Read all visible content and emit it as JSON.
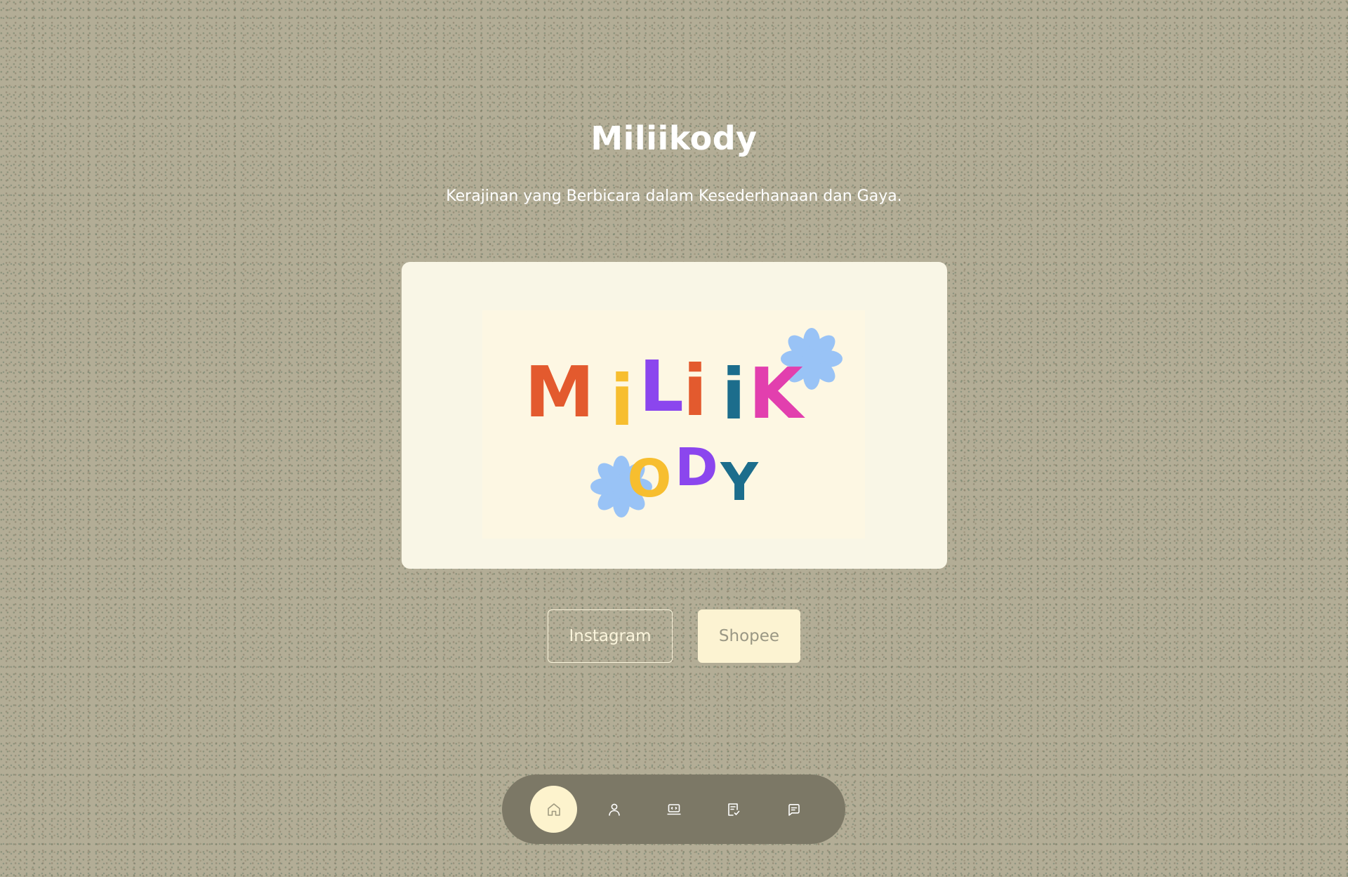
{
  "header": {
    "title": "Miliikody",
    "tagline": "Kerajinan yang Berbicara dalam Kesederhanaan dan Gaya."
  },
  "hero": {
    "logo_text_line1": [
      "M",
      "i",
      "L",
      "i",
      "i",
      "K"
    ],
    "logo_text_line2": [
      "O",
      "D",
      "Y"
    ]
  },
  "links": {
    "instagram_label": "Instagram",
    "shopee_label": "Shopee"
  },
  "dock": {
    "items": [
      {
        "icon": "home-icon",
        "active": true
      },
      {
        "icon": "user-icon",
        "active": false
      },
      {
        "icon": "laptop-icon",
        "active": false
      },
      {
        "icon": "checklist-icon",
        "active": false
      },
      {
        "icon": "message-icon",
        "active": false
      }
    ]
  },
  "colors": {
    "background": "#b3ad96",
    "card": "#f9f6e6",
    "logo_orange": "#e35a2e",
    "logo_yellow": "#f7be2f",
    "logo_purple": "#8b46ee",
    "logo_teal": "#1c6d8c",
    "logo_pink": "#e23fae",
    "logo_flower": "#99c3f6",
    "dock": "#7c7866",
    "dock_active": "#fdf3cd"
  }
}
